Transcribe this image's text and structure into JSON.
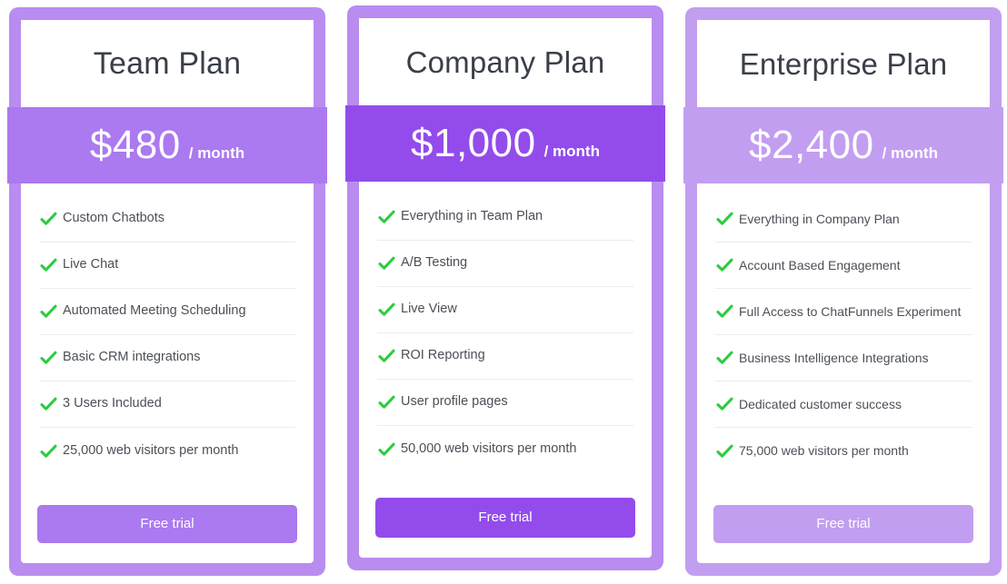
{
  "meta": {
    "component": "pricing-table",
    "currency_symbol": "$",
    "colors": {
      "card_frame_light": "#b98cf0",
      "card_frame_lightest": "#c29ef0",
      "band_team": "#ab79f0",
      "band_company": "#934ceb",
      "band_enterprise": "#c29ef0",
      "check_green": "#2ecc40",
      "title_text": "#3a3f4a",
      "feature_text": "#4b5057",
      "divider": "#ececec",
      "sheet_background": "#ffffff"
    }
  },
  "icons": {
    "check": "check-icon"
  },
  "plans": [
    {
      "id": "team",
      "title": "Team Plan",
      "price": "$480",
      "period": "/ month",
      "cta_label": "Free trial",
      "highlighted": false,
      "features": [
        "Custom Chatbots",
        "Live Chat",
        "Automated Meeting Scheduling",
        "Basic CRM integrations",
        "3 Users Included",
        "25,000 web visitors per month"
      ]
    },
    {
      "id": "company",
      "title": "Company Plan",
      "price": "$1,000",
      "period": "/ month",
      "cta_label": "Free trial",
      "highlighted": true,
      "features": [
        "Everything in Team Plan",
        "A/B Testing",
        "Live View",
        "ROI Reporting",
        "User profile pages",
        "50,000 web visitors per month"
      ]
    },
    {
      "id": "enterprise",
      "title": "Enterprise Plan",
      "price": "$2,400",
      "period": "/ month",
      "cta_label": "Free trial",
      "highlighted": false,
      "features": [
        "Everything in Company Plan",
        "Account Based Engagement",
        "Full Access to ChatFunnels Experiment",
        "Business Intelligence Integrations",
        "Dedicated customer success",
        "75,000 web visitors per month"
      ]
    }
  ]
}
